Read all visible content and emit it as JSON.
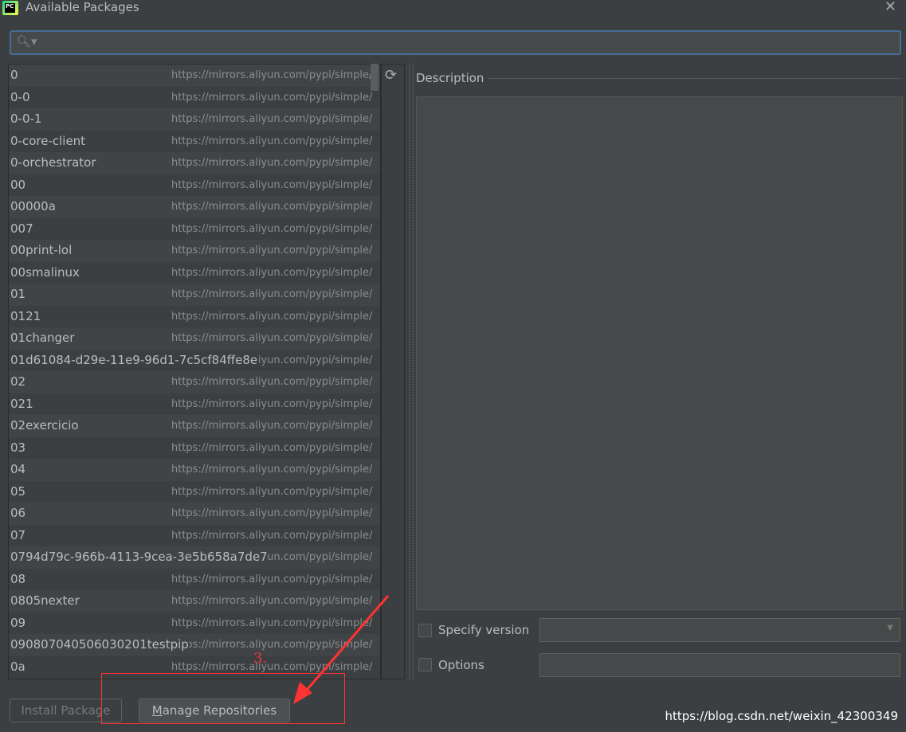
{
  "window": {
    "title": "Available Packages",
    "logo_text": "PC"
  },
  "search": {
    "placeholder": "",
    "value": ""
  },
  "packages": [
    {
      "name": "0",
      "repo": "https://mirrors.aliyun.com/pypi/simple/"
    },
    {
      "name": "0-0",
      "repo": "https://mirrors.aliyun.com/pypi/simple/"
    },
    {
      "name": "0-0-1",
      "repo": "https://mirrors.aliyun.com/pypi/simple/"
    },
    {
      "name": "0-core-client",
      "repo": "https://mirrors.aliyun.com/pypi/simple/"
    },
    {
      "name": "0-orchestrator",
      "repo": "https://mirrors.aliyun.com/pypi/simple/"
    },
    {
      "name": "00",
      "repo": "https://mirrors.aliyun.com/pypi/simple/"
    },
    {
      "name": "00000a",
      "repo": "https://mirrors.aliyun.com/pypi/simple/"
    },
    {
      "name": "007",
      "repo": "https://mirrors.aliyun.com/pypi/simple/"
    },
    {
      "name": "00print-lol",
      "repo": "https://mirrors.aliyun.com/pypi/simple/"
    },
    {
      "name": "00smalinux",
      "repo": "https://mirrors.aliyun.com/pypi/simple/"
    },
    {
      "name": "01",
      "repo": "https://mirrors.aliyun.com/pypi/simple/"
    },
    {
      "name": "0121",
      "repo": "https://mirrors.aliyun.com/pypi/simple/"
    },
    {
      "name": "01changer",
      "repo": "https://mirrors.aliyun.com/pypi/simple/"
    },
    {
      "name": "01d61084-d29e-11e9-96d1-7c5cf84ffe8e",
      "repo": "https://mirrors.aliyun.com/pypi/simple/"
    },
    {
      "name": "02",
      "repo": "https://mirrors.aliyun.com/pypi/simple/"
    },
    {
      "name": "021",
      "repo": "https://mirrors.aliyun.com/pypi/simple/"
    },
    {
      "name": "02exercicio",
      "repo": "https://mirrors.aliyun.com/pypi/simple/"
    },
    {
      "name": "03",
      "repo": "https://mirrors.aliyun.com/pypi/simple/"
    },
    {
      "name": "04",
      "repo": "https://mirrors.aliyun.com/pypi/simple/"
    },
    {
      "name": "05",
      "repo": "https://mirrors.aliyun.com/pypi/simple/"
    },
    {
      "name": "06",
      "repo": "https://mirrors.aliyun.com/pypi/simple/"
    },
    {
      "name": "07",
      "repo": "https://mirrors.aliyun.com/pypi/simple/"
    },
    {
      "name": "0794d79c-966b-4113-9cea-3e5b658a7de7",
      "repo": "https://mirrors.aliyun.com/pypi/simple/"
    },
    {
      "name": "08",
      "repo": "https://mirrors.aliyun.com/pypi/simple/"
    },
    {
      "name": "0805nexter",
      "repo": "https://mirrors.aliyun.com/pypi/simple/"
    },
    {
      "name": "09",
      "repo": "https://mirrors.aliyun.com/pypi/simple/"
    },
    {
      "name": "090807040506030201testpip",
      "repo": "https://mirrors.aliyun.com/pypi/simple/"
    },
    {
      "name": "0a",
      "repo": "https://mirrors.aliyun.com/pypi/simple/"
    }
  ],
  "description": {
    "label": "Description",
    "text": ""
  },
  "options": {
    "specify_version_label": "Specify version",
    "specify_version_checked": false,
    "version_value": "",
    "options_label": "Options",
    "options_checked": false,
    "options_value": ""
  },
  "buttons": {
    "install": "Install Package",
    "manage_mnemonic": "M",
    "manage_rest": "anage Repositories"
  },
  "annotation": {
    "step": "3.",
    "color": "#ff3333"
  },
  "watermark": "https://blog.csdn.net/weixin_42300349"
}
